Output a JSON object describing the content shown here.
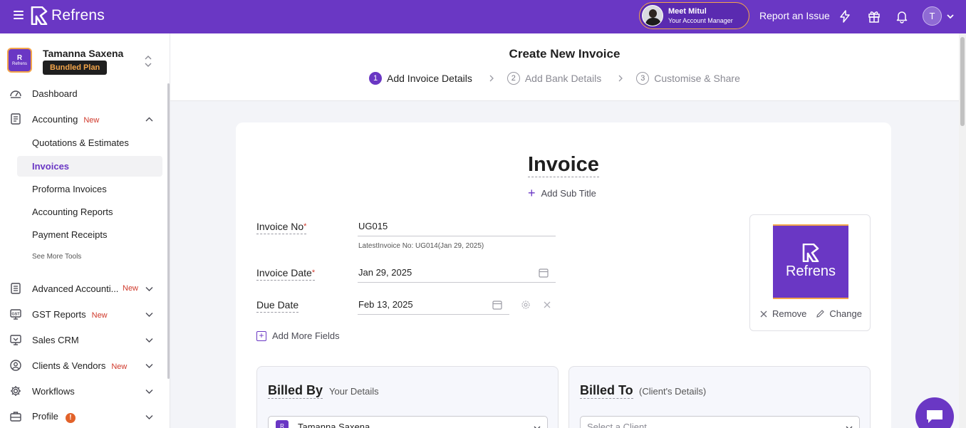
{
  "app": {
    "name": "Refrens"
  },
  "topbar": {
    "account_manager": {
      "name": "Meet Mitul",
      "role": "Your Account Manager"
    },
    "report_label": "Report an Issue",
    "user_initial": "T",
    "icons": [
      "hamburger-icon",
      "lightning-icon",
      "gift-icon",
      "bell-icon",
      "chevron-down-icon"
    ]
  },
  "sidebar": {
    "org": {
      "name": "Tamanna Saxena",
      "plan": "Bundled Plan",
      "logo_text": "Refrens"
    },
    "items": [
      {
        "label": "Dashboard",
        "icon": "dashboard-icon"
      },
      {
        "label": "Accounting",
        "badge": "New",
        "icon": "accounting-icon",
        "expanded": true
      },
      {
        "label": "Advanced Accounti...",
        "badge": "New",
        "icon": "document-icon"
      },
      {
        "label": "GST Reports",
        "badge": "New",
        "icon": "gst-icon"
      },
      {
        "label": "Sales CRM",
        "icon": "crm-icon"
      },
      {
        "label": "Clients & Vendors",
        "badge": "New",
        "icon": "person-icon"
      },
      {
        "label": "Workflows",
        "icon": "gear-icon"
      },
      {
        "label": "Profile",
        "badge": "!",
        "icon": "briefcase-icon"
      }
    ],
    "sub_items": [
      {
        "label": "Quotations & Estimates"
      },
      {
        "label": "Invoices",
        "active": true
      },
      {
        "label": "Proforma Invoices"
      },
      {
        "label": "Accounting Reports"
      },
      {
        "label": "Payment Receipts"
      }
    ],
    "see_more": "See More Tools"
  },
  "header": {
    "title": "Create New Invoice",
    "steps": [
      {
        "num": "1",
        "label": "Add Invoice Details",
        "active": true
      },
      {
        "num": "2",
        "label": "Add Bank Details"
      },
      {
        "num": "3",
        "label": "Customise & Share"
      }
    ]
  },
  "invoice": {
    "title": "Invoice",
    "add_subtitle": "Add Sub Title",
    "invoice_no": {
      "label": "Invoice No",
      "required": "*",
      "value": "UG015",
      "hint": "LatestInvoice No: UG014(Jan 29, 2025)"
    },
    "invoice_date": {
      "label": "Invoice Date",
      "required": "*",
      "value": "Jan 29, 2025"
    },
    "due_date": {
      "label": "Due Date",
      "value": "Feb 13, 2025"
    },
    "add_more_fields": "Add More Fields",
    "logo": {
      "text": "Refrens",
      "remove": "Remove",
      "change": "Change"
    },
    "billed_by": {
      "title": "Billed By",
      "subtitle": "Your Details",
      "selected": "Tamanna Saxena"
    },
    "billed_to": {
      "title": "Billed To",
      "subtitle": "(Client's Details)",
      "placeholder": "Select a Client"
    }
  },
  "colors": {
    "brand": "#6a37c4",
    "accent": "#f3a54a",
    "new_badge": "#d0392b"
  }
}
